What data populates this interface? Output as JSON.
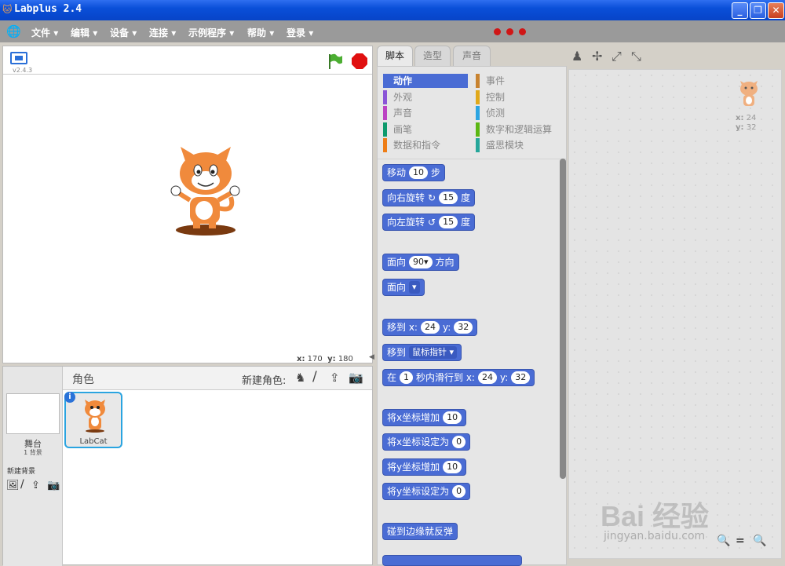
{
  "window": {
    "title": "Labplus 2.4"
  },
  "menu": {
    "items": [
      "文件",
      "编辑",
      "设备",
      "连接",
      "示例程序",
      "帮助",
      "登录"
    ]
  },
  "stage": {
    "version": "v2.4.3",
    "x_label": "x:",
    "x_value": "170",
    "y_label": "y:",
    "y_value": "180"
  },
  "sprites": {
    "title": "角色",
    "new_sprite": "新建角色:",
    "stage_label": "舞台",
    "backdrop_count": "1 背景",
    "new_backdrop": "新建背景",
    "sprite_name": "LabCat"
  },
  "tabs": [
    "脚本",
    "造型",
    "声音"
  ],
  "categories": {
    "left": [
      {
        "label": "动作",
        "color": "#4a6cd4"
      },
      {
        "label": "外观",
        "color": "#8a55d7"
      },
      {
        "label": "声音",
        "color": "#bb42c3"
      },
      {
        "label": "画笔",
        "color": "#0e9a6c"
      },
      {
        "label": "数据和指令",
        "color": "#ee7d16"
      }
    ],
    "right": [
      {
        "label": "事件",
        "color": "#c88330"
      },
      {
        "label": "控制",
        "color": "#e1a91a"
      },
      {
        "label": "侦测",
        "color": "#2ca5e2"
      },
      {
        "label": "数字和逻辑运算",
        "color": "#5cb712"
      },
      {
        "label": "盛思模块",
        "color": "#26a69a"
      }
    ]
  },
  "blocks": {
    "move": [
      "移动",
      "10",
      "步"
    ],
    "turn_right": [
      "向右旋转",
      "15",
      "度"
    ],
    "turn_left": [
      "向左旋转",
      "15",
      "度"
    ],
    "point_dir": [
      "面向",
      "90▾",
      "方向"
    ],
    "point_towards": [
      "面向"
    ],
    "goto_xy": [
      "移到 x:",
      "24",
      "y:",
      "32"
    ],
    "goto": [
      "移到",
      "鼠标指针"
    ],
    "glide": [
      "在",
      "1",
      "秒内滑行到 x:",
      "24",
      "y:",
      "32"
    ],
    "change_x": [
      "将x坐标增加",
      "10"
    ],
    "set_x": [
      "将x坐标设定为",
      "0"
    ],
    "change_y": [
      "将y坐标增加",
      "10"
    ],
    "set_y": [
      "将y坐标设定为",
      "0"
    ],
    "bounce": [
      "碰到边缘就反弹"
    ]
  },
  "script_area": {
    "x_label": "x:",
    "x_value": "24",
    "y_label": "y:",
    "y_value": "32"
  },
  "watermark": {
    "brand": "Bai 经验",
    "url": "jingyan.baidu.com"
  }
}
